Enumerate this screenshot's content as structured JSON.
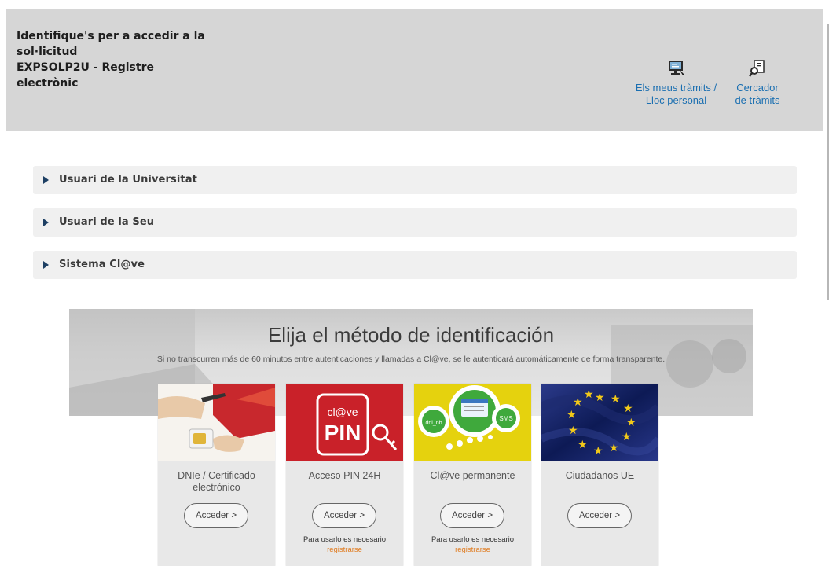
{
  "header": {
    "title": "Identifique's per a accedir a la\nsol·licitud\nEXPSOLP2U - Registre\nelectrònic",
    "links": [
      {
        "label": "Els meus tràmits /\nLloc personal",
        "icon": "monitor-icon"
      },
      {
        "label": "Cercador\nde tràmits",
        "icon": "search-document-icon"
      }
    ]
  },
  "accordion": [
    {
      "label": "Usuari de la Universitat"
    },
    {
      "label": "Usuari de la Seu"
    },
    {
      "label": "Sistema Cl@ve"
    }
  ],
  "banner": {
    "title": "Elija el método de identificación",
    "subtitle": "Si no transcurren más de 60 minutos entre autenticaciones y llamadas a Cl@ve, se le autenticará automáticamente de forma transparente."
  },
  "cards": [
    {
      "title": "DNIe / Certificado\nelectrónico",
      "button": "Acceder  >",
      "note": "",
      "register": ""
    },
    {
      "title": "Acceso PIN 24H",
      "button": "Acceder  >",
      "note": "Para usarlo es necesario",
      "register": "registrarse",
      "img_top": "cl@ve",
      "img_main": "PIN"
    },
    {
      "title": "Cl@ve permanente",
      "button": "Acceder  >",
      "note": "Para usarlo es necesario",
      "register": "registrarse",
      "img_sms": "SMS",
      "img_dni": "dni_nb"
    },
    {
      "title": "Ciudadanos UE",
      "button": "Acceder  >",
      "note": "",
      "register": ""
    }
  ],
  "colors": {
    "header_bg": "#d6d6d6",
    "link": "#1b6fb1",
    "accordion_bg": "#f0f0f0",
    "register_link": "#e07b1f",
    "pin_red": "#d9262c",
    "clave_yellow": "#e8d40c",
    "eu_blue": "#1a2a6c"
  }
}
